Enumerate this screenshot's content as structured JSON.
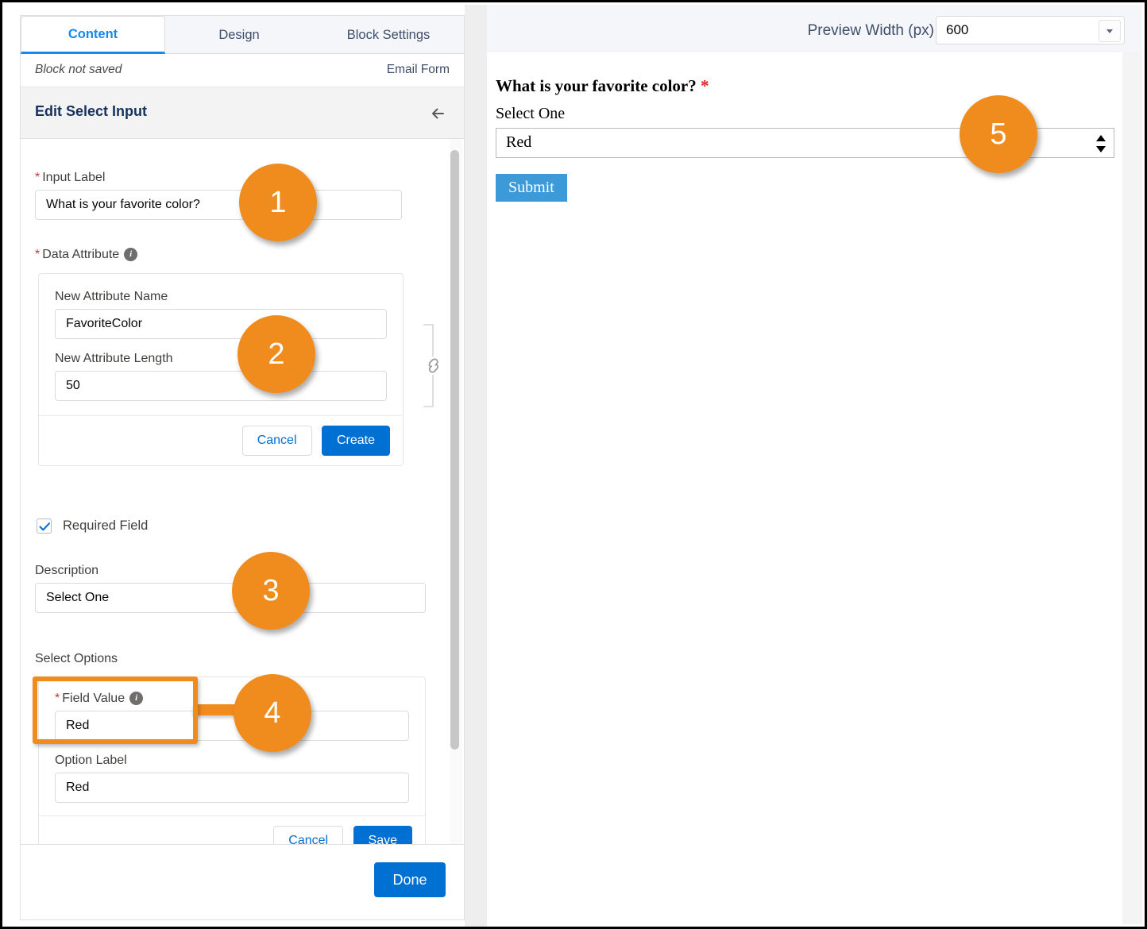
{
  "tabs": [
    {
      "label": "Content",
      "active": true
    },
    {
      "label": "Design",
      "active": false
    },
    {
      "label": "Block Settings",
      "active": false
    }
  ],
  "subbar": {
    "status": "Block not saved",
    "block_name": "Email Form"
  },
  "editor": {
    "title": "Edit Select Input",
    "back_icon": "arrow-left-icon",
    "input_label": {
      "label": "Input Label",
      "required": true,
      "value": "What is your favorite color?"
    },
    "data_attribute": {
      "label": "Data Attribute",
      "required": true,
      "info_icon": "info-icon",
      "link_icon": "link-chain-icon",
      "new_attribute_name": {
        "label": "New Attribute Name",
        "value": "FavoriteColor"
      },
      "new_attribute_length": {
        "label": "New Attribute Length",
        "value": "50"
      },
      "cancel_label": "Cancel",
      "create_label": "Create"
    },
    "required_field": {
      "label": "Required Field",
      "checked": true
    },
    "description": {
      "label": "Description",
      "value": "Select One"
    },
    "select_options": {
      "label": "Select Options",
      "field_value": {
        "label": "Field Value",
        "required": true,
        "info_icon": "info-icon",
        "value": "Red"
      },
      "option_label": {
        "label": "Option Label",
        "value": "Red"
      },
      "cancel_label": "Cancel",
      "save_label": "Save"
    },
    "done_label": "Done"
  },
  "preview": {
    "width_label": "Preview Width (px)",
    "width_value": "600",
    "question": "What is your favorite color?",
    "question_required_marker": "*",
    "description": "Select One",
    "selected_option": "Red",
    "submit_label": "Submit"
  },
  "callouts": [
    {
      "number": "1"
    },
    {
      "number": "2"
    },
    {
      "number": "3"
    },
    {
      "number": "4"
    },
    {
      "number": "5"
    }
  ],
  "colors": {
    "accent_blue": "#0070d2",
    "tab_active": "#1589ee",
    "callout_orange": "#f08c1e",
    "required_red": "#c23934",
    "submit_blue": "#3d9ad8"
  }
}
